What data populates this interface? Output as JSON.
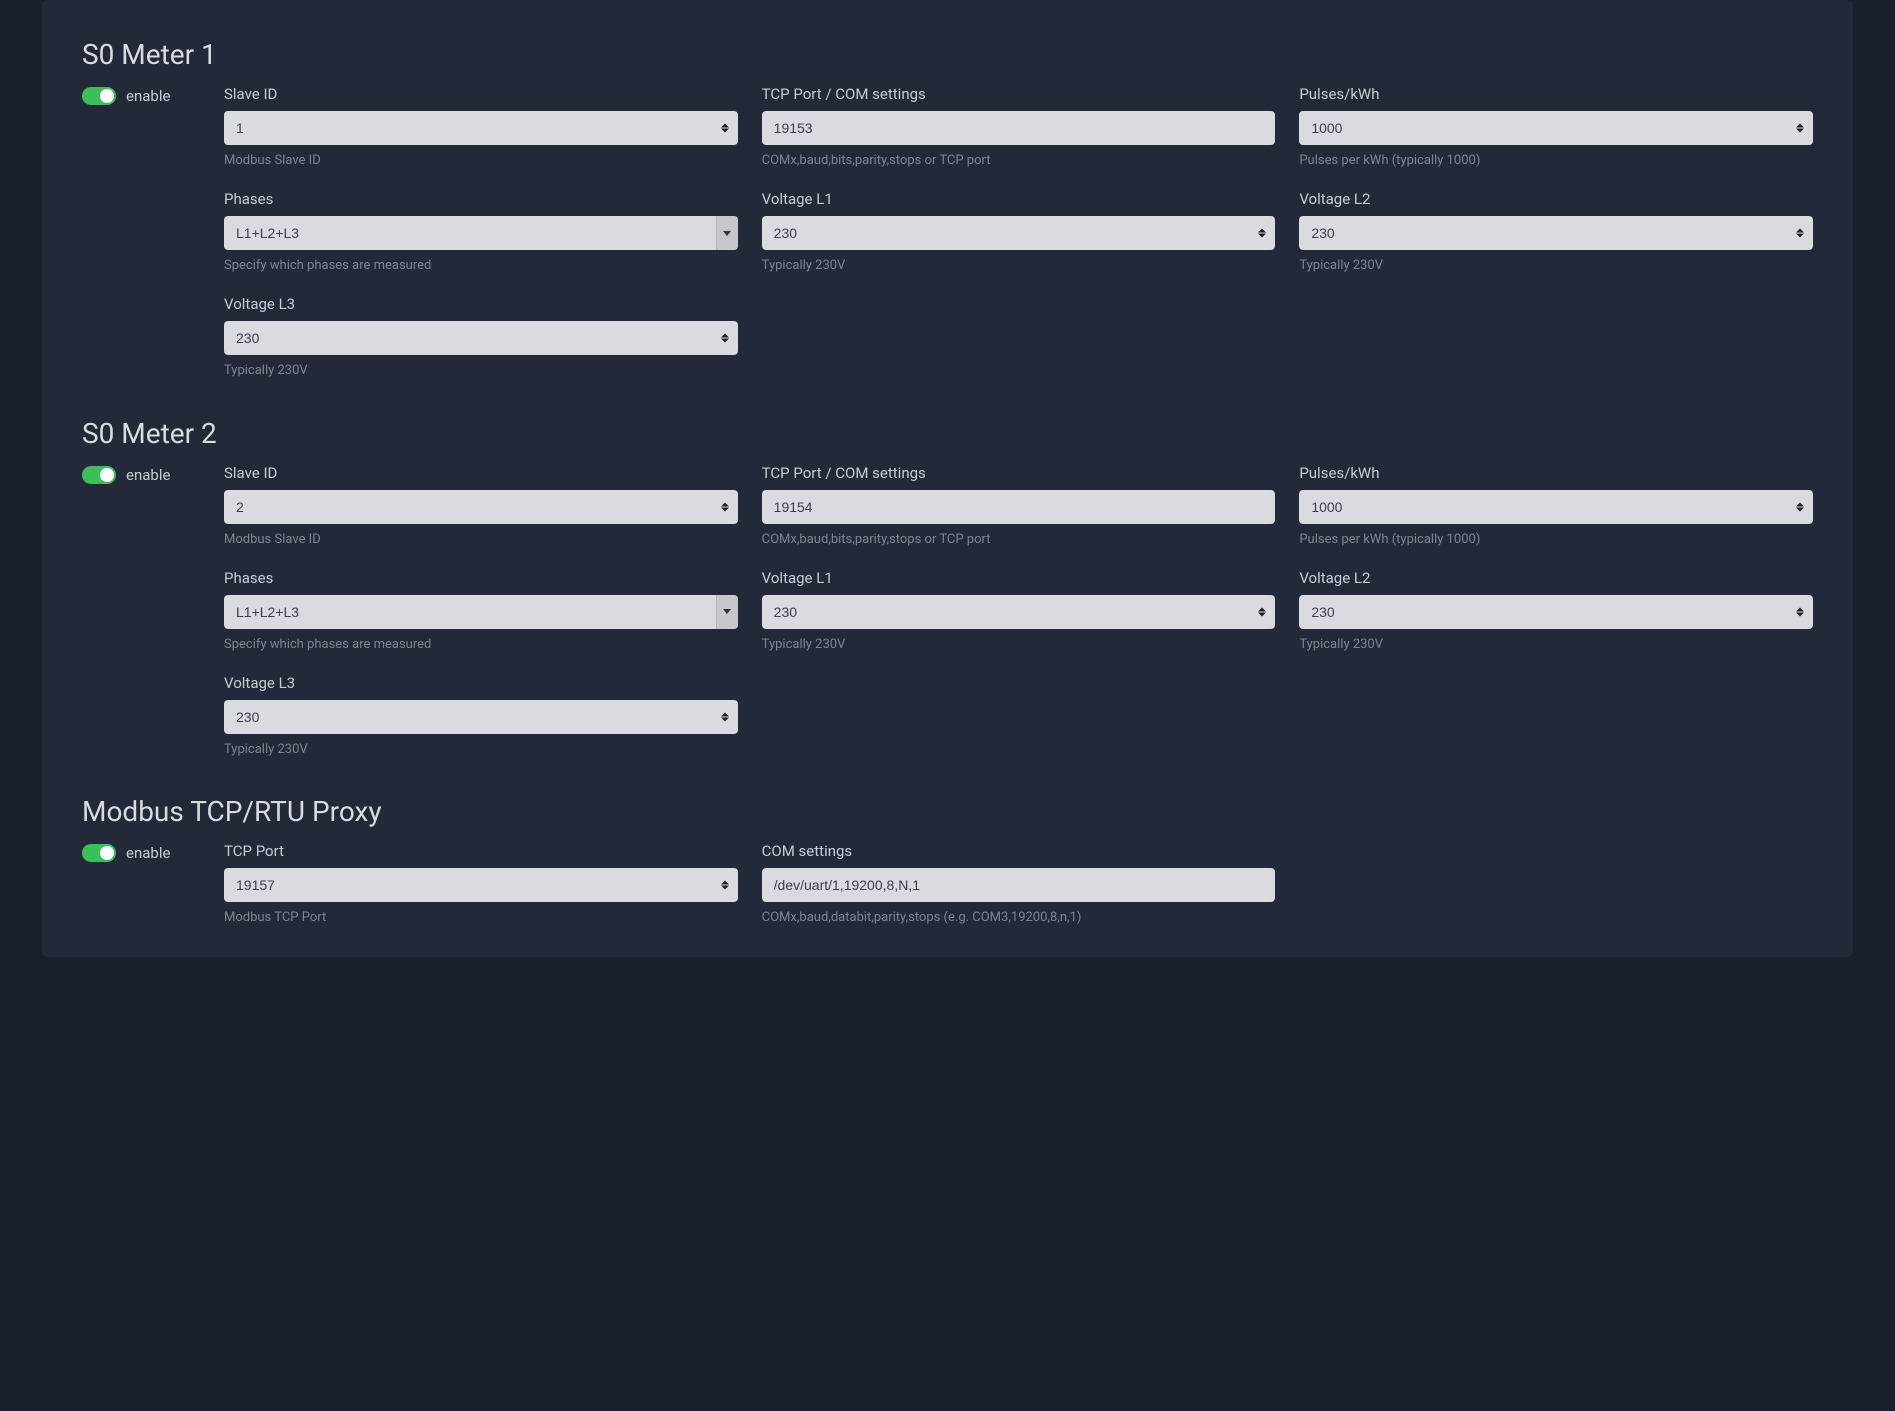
{
  "sections": [
    {
      "title": "S0 Meter 1",
      "enable": {
        "label": "enable",
        "on": true
      },
      "fields": [
        {
          "label": "Slave ID",
          "value": "1",
          "type": "number",
          "hint": "Modbus Slave ID"
        },
        {
          "label": "TCP Port / COM settings",
          "value": "19153",
          "type": "text",
          "hint": "COMx,baud,bits,parity,stops or TCP port"
        },
        {
          "label": "Pulses/kWh",
          "value": "1000",
          "type": "number",
          "hint": "Pulses per kWh (typically 1000)"
        },
        {
          "label": "Phases",
          "value": "L1+L2+L3",
          "type": "select",
          "hint": "Specify which phases are measured"
        },
        {
          "label": "Voltage L1",
          "value": "230",
          "type": "number",
          "hint": "Typically 230V"
        },
        {
          "label": "Voltage L2",
          "value": "230",
          "type": "number",
          "hint": "Typically 230V"
        },
        {
          "label": "Voltage L3",
          "value": "230",
          "type": "number",
          "hint": "Typically 230V"
        }
      ]
    },
    {
      "title": "S0 Meter 2",
      "enable": {
        "label": "enable",
        "on": true
      },
      "fields": [
        {
          "label": "Slave ID",
          "value": "2",
          "type": "number",
          "hint": "Modbus Slave ID"
        },
        {
          "label": "TCP Port / COM settings",
          "value": "19154",
          "type": "text",
          "hint": "COMx,baud,bits,parity,stops or TCP port"
        },
        {
          "label": "Pulses/kWh",
          "value": "1000",
          "type": "number",
          "hint": "Pulses per kWh (typically 1000)"
        },
        {
          "label": "Phases",
          "value": "L1+L2+L3",
          "type": "select",
          "hint": "Specify which phases are measured"
        },
        {
          "label": "Voltage L1",
          "value": "230",
          "type": "number",
          "hint": "Typically 230V"
        },
        {
          "label": "Voltage L2",
          "value": "230",
          "type": "number",
          "hint": "Typically 230V"
        },
        {
          "label": "Voltage L3",
          "value": "230",
          "type": "number",
          "hint": "Typically 230V"
        }
      ]
    },
    {
      "title": "Modbus TCP/RTU Proxy",
      "enable": {
        "label": "enable",
        "on": true
      },
      "fields": [
        {
          "label": "TCP Port",
          "value": "19157",
          "type": "number",
          "hint": "Modbus TCP Port"
        },
        {
          "label": "COM settings",
          "value": "/dev/uart/1,19200,8,N,1",
          "type": "text",
          "hint": "COMx,baud,databit,parity,stops (e.g. COM3,19200,8,n,1)"
        }
      ]
    }
  ]
}
